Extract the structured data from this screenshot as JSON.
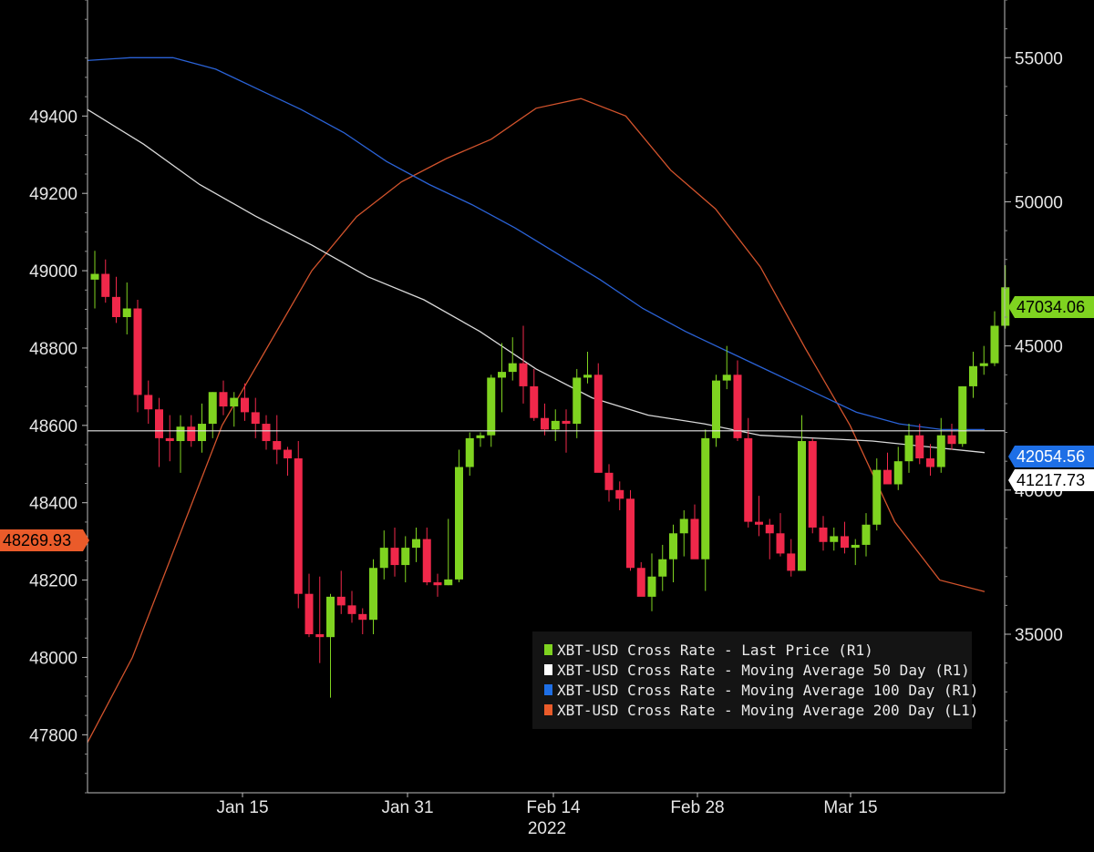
{
  "chart_data": {
    "type": "candlestick",
    "x_tick_labels": [
      "Jan 15",
      "Jan 31",
      "Feb 14",
      "Feb 28",
      "Mar 15"
    ],
    "x_year_label": "2022",
    "left_axis": {
      "ylim": [
        47650,
        49700
      ],
      "ticks": [
        47800,
        48000,
        48200,
        48400,
        48600,
        48800,
        49000,
        49200,
        49400
      ],
      "tick_labels": [
        "47800",
        "48000",
        "48200",
        "48400",
        "48600",
        "48800",
        "49000",
        "49200",
        "49400"
      ]
    },
    "right_axis": {
      "ylim": [
        29500,
        57000
      ],
      "ticks": [
        35000,
        40000,
        45000,
        50000,
        55000
      ],
      "tick_labels": [
        "35000",
        "40000",
        "45000",
        "50000",
        "55000"
      ]
    },
    "reference_line": 42054.56,
    "value_tags": {
      "last_price": "47034.06",
      "ma100": "42054.56",
      "ma50": "41217.73",
      "ma200": "48269.93"
    },
    "legend": [
      {
        "label": "XBT-USD Cross Rate - Last Price (R1)",
        "color": "#7fd320"
      },
      {
        "label": "XBT-USD Cross Rate - Moving Average 50 Day (R1)",
        "color": "#ffffff"
      },
      {
        "label": "XBT-USD Cross Rate - Moving Average 100 Day (R1)",
        "color": "#1e6fe6"
      },
      {
        "label": "XBT-USD Cross Rate - Moving Average 200 Day (L1)",
        "color": "#ea5b2a"
      }
    ],
    "colors": {
      "up": "#7fd320",
      "down": "#f0284a",
      "ma50": "#d9d9d9",
      "ma100": "#2a62d6",
      "ma200": "#d2532c",
      "ref": "#e6e6e6",
      "ma200_tag": "#ea5b2a",
      "last_tag": "#7fd320",
      "ma100_tag": "#1e6fe6",
      "ma50_tag": "#ffffff"
    },
    "candles": [
      {
        "o": 47300,
        "h": 48300,
        "l": 46300,
        "c": 47500
      },
      {
        "o": 47500,
        "h": 48000,
        "l": 46500,
        "c": 46700
      },
      {
        "o": 46700,
        "h": 47400,
        "l": 45800,
        "c": 46000
      },
      {
        "o": 46000,
        "h": 47200,
        "l": 45400,
        "c": 46300
      },
      {
        "o": 46300,
        "h": 46600,
        "l": 42700,
        "c": 43300
      },
      {
        "o": 43300,
        "h": 43800,
        "l": 42300,
        "c": 42800
      },
      {
        "o": 42800,
        "h": 43200,
        "l": 40800,
        "c": 41800
      },
      {
        "o": 41800,
        "h": 42600,
        "l": 41000,
        "c": 41700
      },
      {
        "o": 41700,
        "h": 42600,
        "l": 40600,
        "c": 42200
      },
      {
        "o": 42200,
        "h": 42600,
        "l": 41500,
        "c": 41700
      },
      {
        "o": 41700,
        "h": 43000,
        "l": 41300,
        "c": 42300
      },
      {
        "o": 42300,
        "h": 43400,
        "l": 41800,
        "c": 43400
      },
      {
        "o": 43400,
        "h": 43800,
        "l": 42600,
        "c": 42900
      },
      {
        "o": 42900,
        "h": 43400,
        "l": 42200,
        "c": 43200
      },
      {
        "o": 43200,
        "h": 43700,
        "l": 42400,
        "c": 42700
      },
      {
        "o": 42700,
        "h": 43200,
        "l": 41800,
        "c": 42300
      },
      {
        "o": 42300,
        "h": 42600,
        "l": 41400,
        "c": 41700
      },
      {
        "o": 41700,
        "h": 42600,
        "l": 40900,
        "c": 41400
      },
      {
        "o": 41400,
        "h": 41500,
        "l": 40500,
        "c": 41100
      },
      {
        "o": 41100,
        "h": 41700,
        "l": 35900,
        "c": 36400
      },
      {
        "o": 36400,
        "h": 37100,
        "l": 34900,
        "c": 35000
      },
      {
        "o": 35000,
        "h": 37000,
        "l": 34000,
        "c": 34900
      },
      {
        "o": 34900,
        "h": 36400,
        "l": 32800,
        "c": 36300
      },
      {
        "o": 36300,
        "h": 37200,
        "l": 35700,
        "c": 36000
      },
      {
        "o": 36000,
        "h": 36500,
        "l": 35400,
        "c": 35700
      },
      {
        "o": 35700,
        "h": 35900,
        "l": 35000,
        "c": 35500
      },
      {
        "o": 35500,
        "h": 37600,
        "l": 35000,
        "c": 37300
      },
      {
        "o": 37300,
        "h": 38600,
        "l": 36900,
        "c": 38000
      },
      {
        "o": 38000,
        "h": 38700,
        "l": 37000,
        "c": 37400
      },
      {
        "o": 37400,
        "h": 38400,
        "l": 36800,
        "c": 38000
      },
      {
        "o": 38000,
        "h": 38700,
        "l": 37500,
        "c": 38300
      },
      {
        "o": 38300,
        "h": 38700,
        "l": 36700,
        "c": 36800
      },
      {
        "o": 36800,
        "h": 37100,
        "l": 36300,
        "c": 36700
      },
      {
        "o": 36700,
        "h": 39000,
        "l": 36700,
        "c": 36900
      },
      {
        "o": 36900,
        "h": 41400,
        "l": 36800,
        "c": 40800
      },
      {
        "o": 40800,
        "h": 42000,
        "l": 40500,
        "c": 41800
      },
      {
        "o": 41800,
        "h": 42000,
        "l": 41500,
        "c": 41900
      },
      {
        "o": 41900,
        "h": 44000,
        "l": 41500,
        "c": 43900
      },
      {
        "o": 43900,
        "h": 45100,
        "l": 42700,
        "c": 44100
      },
      {
        "o": 44100,
        "h": 45300,
        "l": 43800,
        "c": 44400
      },
      {
        "o": 44400,
        "h": 45700,
        "l": 43000,
        "c": 43600
      },
      {
        "o": 43600,
        "h": 44200,
        "l": 42400,
        "c": 42500
      },
      {
        "o": 42500,
        "h": 43000,
        "l": 41900,
        "c": 42100
      },
      {
        "o": 42100,
        "h": 42800,
        "l": 41700,
        "c": 42400
      },
      {
        "o": 42400,
        "h": 42800,
        "l": 41300,
        "c": 42300
      },
      {
        "o": 42300,
        "h": 44200,
        "l": 41800,
        "c": 43900
      },
      {
        "o": 43900,
        "h": 44800,
        "l": 43700,
        "c": 44000
      },
      {
        "o": 44000,
        "h": 44400,
        "l": 40700,
        "c": 40600
      },
      {
        "o": 40600,
        "h": 40900,
        "l": 39600,
        "c": 40000
      },
      {
        "o": 40000,
        "h": 40300,
        "l": 39300,
        "c": 39700
      },
      {
        "o": 39700,
        "h": 40000,
        "l": 37200,
        "c": 37300
      },
      {
        "o": 37300,
        "h": 37500,
        "l": 36900,
        "c": 36300
      },
      {
        "o": 36300,
        "h": 37800,
        "l": 35800,
        "c": 37000
      },
      {
        "o": 37000,
        "h": 38100,
        "l": 36500,
        "c": 37600
      },
      {
        "o": 37600,
        "h": 38800,
        "l": 36800,
        "c": 38500
      },
      {
        "o": 38500,
        "h": 39300,
        "l": 37700,
        "c": 39000
      },
      {
        "o": 39000,
        "h": 39500,
        "l": 37800,
        "c": 37600
      },
      {
        "o": 37600,
        "h": 42100,
        "l": 36500,
        "c": 41800
      },
      {
        "o": 41800,
        "h": 44000,
        "l": 41500,
        "c": 43800
      },
      {
        "o": 43800,
        "h": 45000,
        "l": 43500,
        "c": 44000
      },
      {
        "o": 44000,
        "h": 44500,
        "l": 41700,
        "c": 41800
      },
      {
        "o": 41800,
        "h": 42500,
        "l": 38700,
        "c": 38900
      },
      {
        "o": 38900,
        "h": 39800,
        "l": 38400,
        "c": 38800
      },
      {
        "o": 38800,
        "h": 39000,
        "l": 37600,
        "c": 38500
      },
      {
        "o": 38500,
        "h": 39200,
        "l": 37700,
        "c": 37800
      },
      {
        "o": 37800,
        "h": 38300,
        "l": 37000,
        "c": 37200
      },
      {
        "o": 37200,
        "h": 42600,
        "l": 37200,
        "c": 41700
      },
      {
        "o": 41700,
        "h": 41800,
        "l": 38500,
        "c": 38700
      },
      {
        "o": 38700,
        "h": 39100,
        "l": 37900,
        "c": 38200
      },
      {
        "o": 38200,
        "h": 38700,
        "l": 37900,
        "c": 38400
      },
      {
        "o": 38400,
        "h": 38900,
        "l": 37800,
        "c": 38000
      },
      {
        "o": 38000,
        "h": 38300,
        "l": 37400,
        "c": 38100
      },
      {
        "o": 38100,
        "h": 39200,
        "l": 37700,
        "c": 38800
      },
      {
        "o": 38800,
        "h": 41100,
        "l": 38600,
        "c": 40700
      },
      {
        "o": 40700,
        "h": 41300,
        "l": 40300,
        "c": 40200
      },
      {
        "o": 40200,
        "h": 41500,
        "l": 40000,
        "c": 41000
      },
      {
        "o": 41000,
        "h": 42300,
        "l": 40600,
        "c": 41900
      },
      {
        "o": 41900,
        "h": 42300,
        "l": 40900,
        "c": 41100
      },
      {
        "o": 41100,
        "h": 41600,
        "l": 40500,
        "c": 40800
      },
      {
        "o": 40800,
        "h": 42500,
        "l": 40600,
        "c": 41900
      },
      {
        "o": 41900,
        "h": 42300,
        "l": 41400,
        "c": 41600
      },
      {
        "o": 41600,
        "h": 43600,
        "l": 41500,
        "c": 43600
      },
      {
        "o": 43600,
        "h": 44800,
        "l": 43200,
        "c": 44300
      },
      {
        "o": 44300,
        "h": 45000,
        "l": 44000,
        "c": 44400
      },
      {
        "o": 44400,
        "h": 46200,
        "l": 44300,
        "c": 45700
      },
      {
        "o": 45700,
        "h": 47800,
        "l": 45600,
        "c": 47034
      }
    ],
    "ma50": [
      53200,
      52000,
      50600,
      49500,
      48500,
      47400,
      46600,
      45500,
      44200,
      43200,
      42600,
      42300,
      41900,
      41800,
      41700,
      41500,
      41300
    ],
    "ma100": [
      54900,
      55000,
      55000,
      54600,
      53900,
      53200,
      52400,
      51400,
      50600,
      49900,
      49100,
      48200,
      47300,
      46300,
      45500,
      44800,
      44100,
      43400,
      42700,
      42300,
      42100,
      42100
    ],
    "ma200": [
      47780,
      48000,
      48300,
      48600,
      48800,
      49000,
      49140,
      49230,
      49290,
      49340,
      49420,
      49445,
      49400,
      49260,
      49160,
      49010,
      48800,
      48600,
      48350,
      48200,
      48170
    ]
  }
}
